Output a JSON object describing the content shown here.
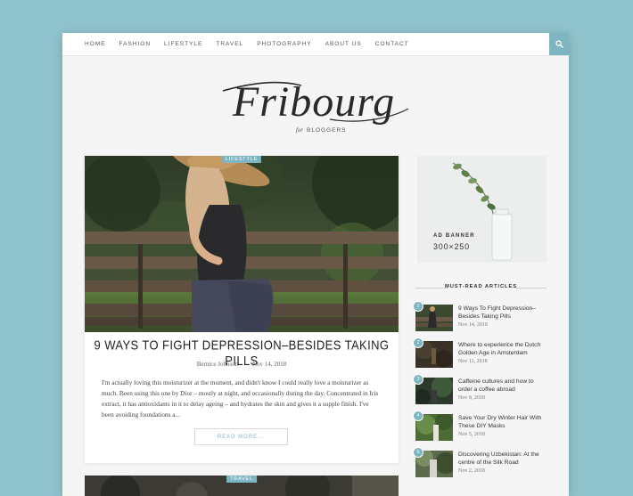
{
  "nav": {
    "items": [
      "HOME",
      "FASHION",
      "LIFESTYLE",
      "TRAVEL",
      "PHOTOGRAPHY",
      "ABOUT US",
      "CONTACT"
    ]
  },
  "logo": {
    "title": "Fribourg",
    "for": "for",
    "subtitle": "BLOGGERS"
  },
  "post": {
    "category": "LIFESTYLE",
    "title": "9 WAYS TO FIGHT DEPRESSION–BESIDES TAKING PILLS",
    "author": "Bernice Johnson",
    "date": "Nov 14, 2018",
    "excerpt": "I'm actually loving this moisturizer at the moment, and didn't know I could really love a moisturizer as much. Been using this one by Dior – mostly at night, and occasionally during the day. Concentrated in Iris extract, it has antioxidants in it to delay ageing – and hydrates the skin and gives it a supple finish. I've been avoiding foundations a...",
    "read_more": "READ MORE..."
  },
  "post2": {
    "category": "TRAVEL"
  },
  "ad": {
    "label": "AD BANNER",
    "size": "300×250"
  },
  "widget": {
    "title": "MUST-READ ARTICLES",
    "articles": [
      {
        "num": "1",
        "title": "9 Ways To Fight Depression–Besides Taking Pills",
        "date": "Nov 14, 2018"
      },
      {
        "num": "2",
        "title": "Where to experience the Dutch Golden Age in Amsterdam",
        "date": "Nov 11, 2018"
      },
      {
        "num": "3",
        "title": "Caffeine cultures and how to order a coffee abroad",
        "date": "Nov 8, 2018"
      },
      {
        "num": "4",
        "title": "Save Your Dry Winter Hair With These DIY Masks",
        "date": "Nov 5, 2018"
      },
      {
        "num": "5",
        "title": "Discovering Uzbekistan: At the centre of the Silk Road",
        "date": "Nov 2, 2018"
      }
    ]
  },
  "colors": {
    "accent": "#7db5c0",
    "background": "#8fc3cc",
    "page": "#f5f5f5"
  }
}
